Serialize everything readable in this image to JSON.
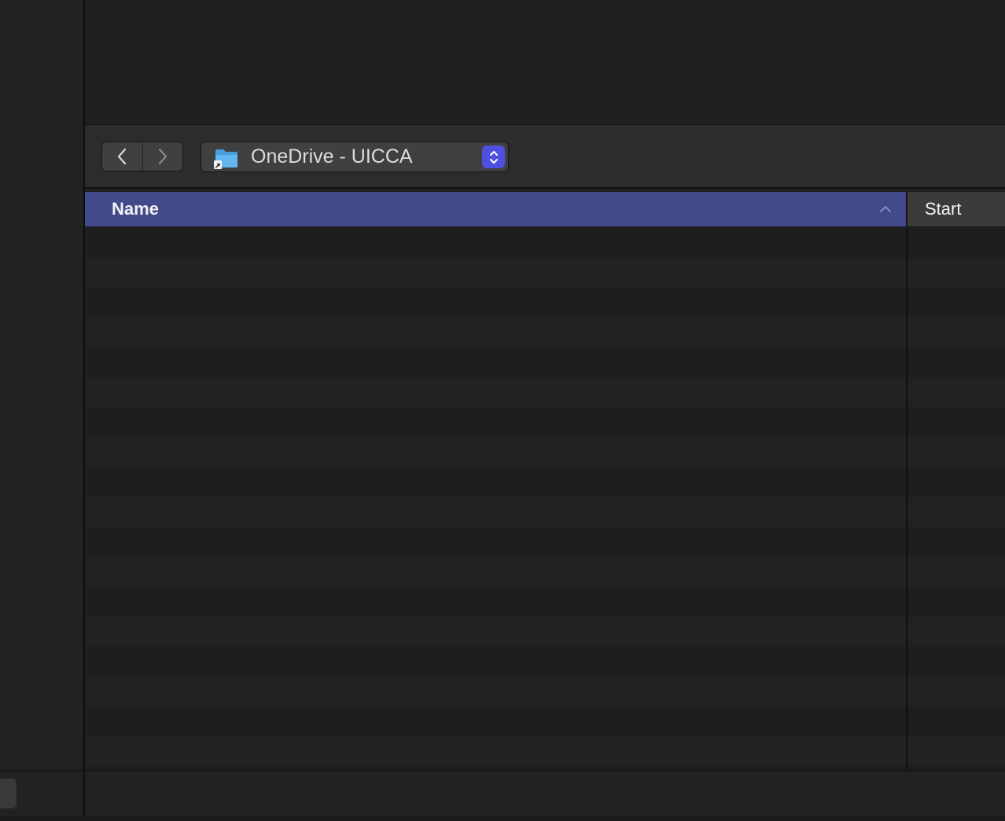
{
  "toolbar": {
    "back_icon": "chevron-left-icon",
    "forward_icon": "chevron-right-icon",
    "path_popup": {
      "icon": "folder-alias-icon",
      "label": "OneDrive - UICCA",
      "arrows_icon": "up-down-chevron-icon"
    }
  },
  "table": {
    "columns": [
      {
        "label": "Name",
        "sorted": true,
        "sort_direction": "ascending"
      },
      {
        "label": "Start"
      }
    ],
    "rows": []
  },
  "colors": {
    "accent": "#4f4fe0",
    "selected_header": "#434a8b",
    "background": "#202020"
  }
}
